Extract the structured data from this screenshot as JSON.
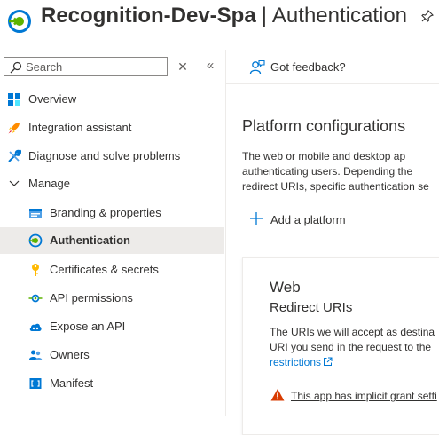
{
  "header": {
    "resource_name": "Recognition-Dev-Spa",
    "separator": "|",
    "page_title": "Authentication"
  },
  "search": {
    "placeholder": "Search"
  },
  "sidebar": {
    "items": [
      {
        "label": "Overview",
        "icon": "overview-icon"
      },
      {
        "label": "Integration assistant",
        "icon": "rocket-icon"
      },
      {
        "label": "Diagnose and solve problems",
        "icon": "wrench-icon"
      },
      {
        "label": "Manage",
        "icon": "chevron-down-icon"
      },
      {
        "label": "Branding & properties",
        "icon": "branding-icon"
      },
      {
        "label": "Authentication",
        "icon": "authentication-icon",
        "active": true
      },
      {
        "label": "Certificates & secrets",
        "icon": "key-icon"
      },
      {
        "label": "API permissions",
        "icon": "api-permissions-icon"
      },
      {
        "label": "Expose an API",
        "icon": "cloud-icon"
      },
      {
        "label": "Owners",
        "icon": "people-icon"
      },
      {
        "label": "Manifest",
        "icon": "manifest-icon"
      }
    ]
  },
  "toolbar": {
    "feedback_label": "Got feedback?"
  },
  "main": {
    "section_title": "Platform configurations",
    "description_lines": [
      "The web or mobile and desktop ap",
      "authenticating users. Depending the",
      "redirect URIs, specific authentication se"
    ],
    "add_platform_label": "Add a platform",
    "card": {
      "title": "Web",
      "subtitle": "Redirect URIs",
      "desc_line1": "The URIs we will accept as destina",
      "desc_line2": "URI you send in the request to the",
      "link_text": "restrictions",
      "warning_text": "This app has implicit grant setti"
    }
  },
  "colors": {
    "accent": "#0078d4",
    "active_bg": "#edebe9",
    "warning": "#d83b01"
  }
}
